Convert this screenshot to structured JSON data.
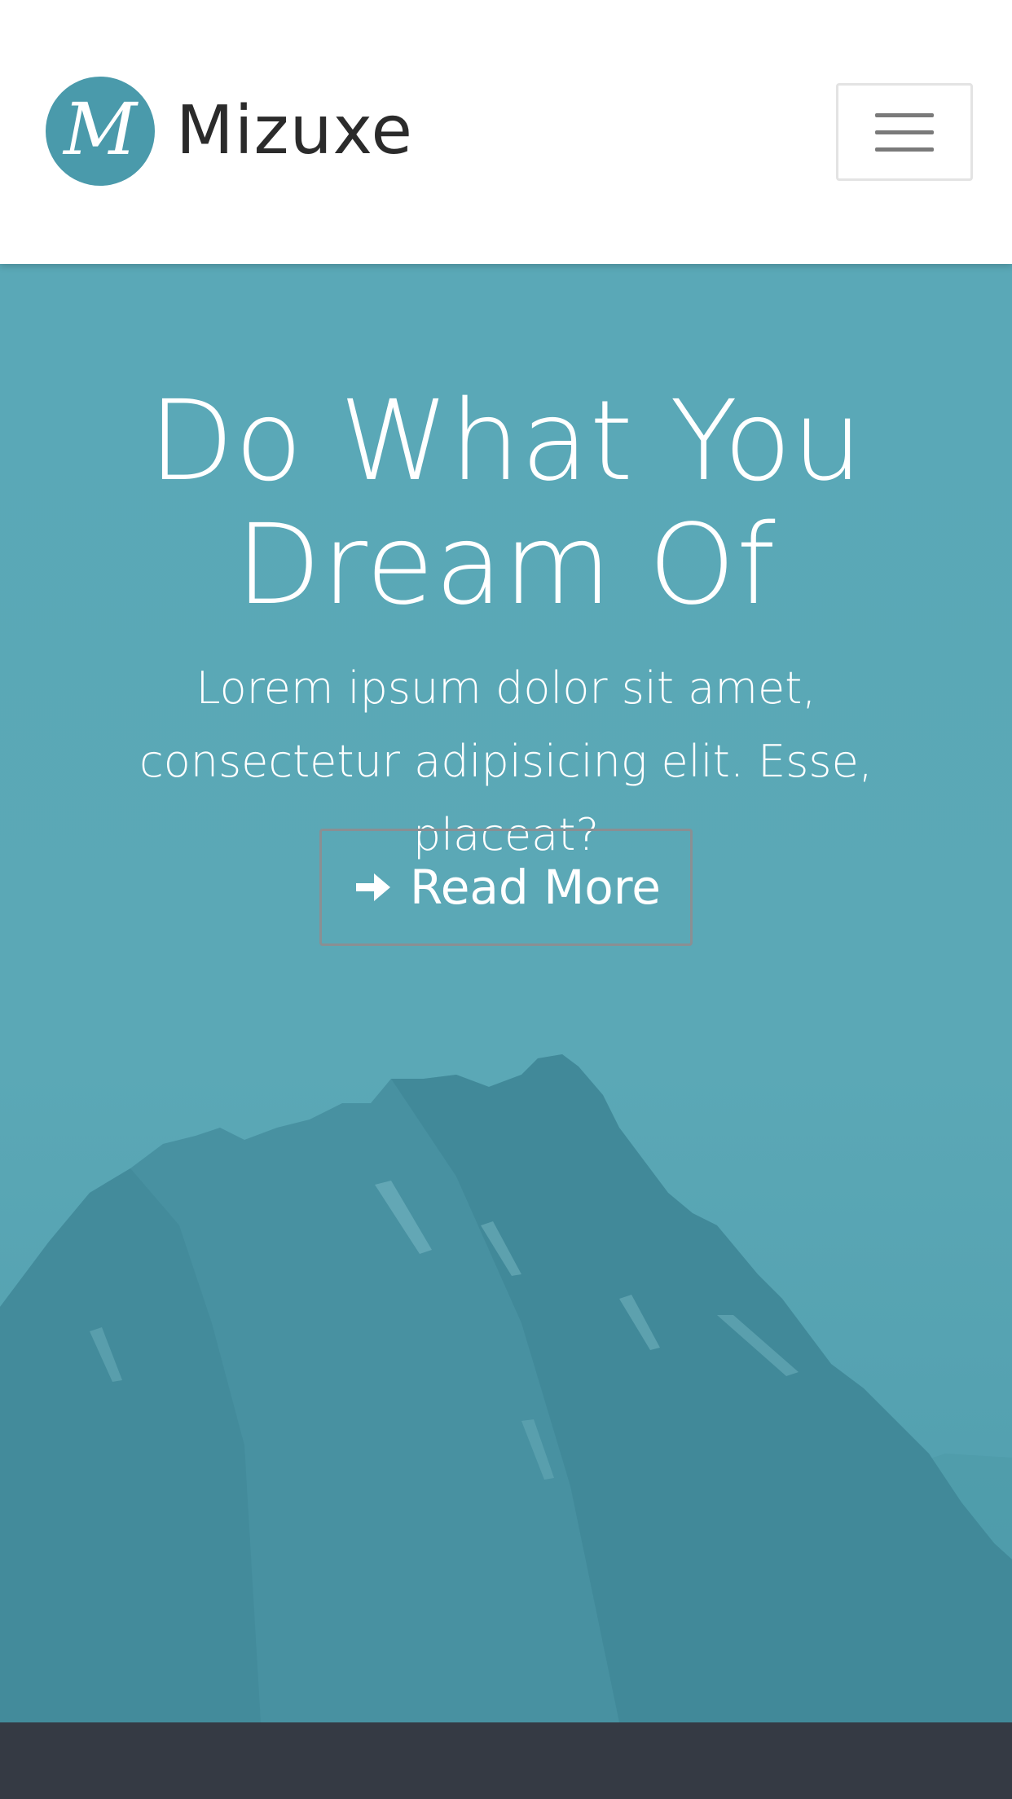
{
  "header": {
    "brand_letter": "M",
    "brand_name": "Mizuxe",
    "menu_icon": "hamburger-menu-icon"
  },
  "hero": {
    "title": "Do What You Dream Of",
    "subtitle": "Lorem ipsum dolor sit amet, consectetur adipisicing elit. Esse, placeat?",
    "cta_label": "Read More",
    "cta_icon": "arrow-right-icon",
    "background_image": "teal-tinted-mountain"
  },
  "colors": {
    "brand_accent": "#4a9aab",
    "hero_background": "#5aa8b7",
    "footer_background": "#353a44",
    "brand_text": "#2b2b2b"
  }
}
